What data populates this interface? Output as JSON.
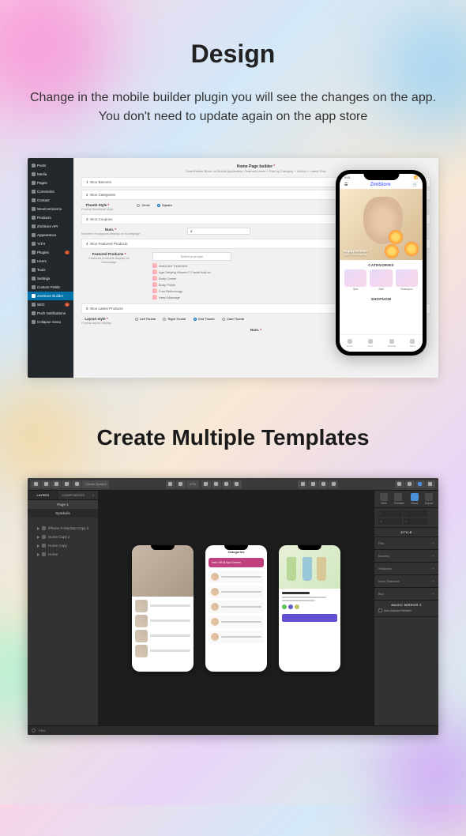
{
  "heading1": "Design",
  "subtitle": "Change in the mobile builder plugin you will see the changes on the app. You don't need to update again on the app store",
  "heading2": "Create Multiple Templates",
  "wp": {
    "sidebar": [
      {
        "label": "Posts"
      },
      {
        "label": "Media"
      },
      {
        "label": "Pages"
      },
      {
        "label": "Comments"
      },
      {
        "label": "Contact"
      },
      {
        "label": "WooCommerce"
      },
      {
        "label": "Products"
      },
      {
        "label": "ZiniStore API"
      },
      {
        "label": "Appearance"
      },
      {
        "label": "YITH"
      },
      {
        "label": "Plugins",
        "badge": "1"
      },
      {
        "label": "Users"
      },
      {
        "label": "Tools"
      },
      {
        "label": "Settings"
      },
      {
        "label": "Custom Fields"
      },
      {
        "label": "ZiniStore Builder",
        "active": true
      },
      {
        "label": "SEO",
        "badge": "1"
      },
      {
        "label": "Push Notifications"
      },
      {
        "label": "Collapse menu"
      }
    ],
    "title": "Home Page builder",
    "desc": "Data Builder Block on Mobile Application: Featured news + Post by Category + Videos + Latest Post",
    "rows": {
      "banners": "Woo Banners",
      "categories": "Woo Categories",
      "coupons": "Woo Coupons",
      "featured": "Woo Featured Products",
      "latest": "Woo Latest Products"
    },
    "fields": {
      "thumb_label": "Thumb Style",
      "thumb_desc": "Format thumbnail style",
      "thumb_circle": "Circle",
      "thumb_square": "Square",
      "num_label": "Num.",
      "num_desc": "Number of coupons display on homepage",
      "num_value": "3",
      "featured_label": "Featured Products",
      "featured_desc": "Featured products display on homepage",
      "select_placeholder": "Select post type",
      "layout_label": "Layout style",
      "layout_desc": "Format layout display",
      "layout_left": "Left Thumb",
      "layout_right": "Right Thumb",
      "layout_grid": "Grid Thumb",
      "layout_card": "Card Thumb",
      "num2_label": "Num."
    },
    "products": [
      "Abdomen Treatment",
      "Age Defying Vitamin C Facial Add-on",
      "Body Cream",
      "Body Polish",
      "Foot Reflexology",
      "Head Massage"
    ]
  },
  "phone": {
    "time": "9:41",
    "brand": "ZiniStore",
    "hero_title": "Happy Winter!",
    "hero_sub": "Sale off everything",
    "cat_title": "CATEGORIES",
    "cats": [
      "Spa",
      "Nail",
      "Shampoo"
    ],
    "shop_title": "SHOPNOW",
    "tabs": [
      "Home",
      "Shop",
      "Wishlist",
      "More"
    ]
  },
  "editor": {
    "toolbar": {
      "insert": "Insert",
      "symbols": "Symbols",
      "group": "Group",
      "ungroup": "Ungroup",
      "create_symbol": "Create Symbol",
      "forward": "Forward",
      "backward": "Backward",
      "zoom": "Zoom",
      "zoom_pct": "67%",
      "edit": "Edit",
      "rotate": "Rotate",
      "flatten": "Flatten",
      "scale": "Scale",
      "union": "Union",
      "subtract": "Subtract",
      "intersect": "Intersect",
      "difference": "Difference",
      "view": "View",
      "preview": "Preview",
      "cloud": "Cloud",
      "export": "Export"
    },
    "left": {
      "tab_layers": "LAYERS",
      "tab_components": "COMPONENTS",
      "page": "Page 1",
      "symbols": "Symbols",
      "layers": [
        "iPhone-X-Mockup Copy 2",
        "Home Copy 2",
        "Home Copy",
        "Home"
      ]
    },
    "right": {
      "view": "View",
      "preview": "Preview",
      "cloud": "Cloud",
      "export": "Export",
      "style": "STYLE",
      "fills": "Fills",
      "borders": "Borders",
      "shadows": "Shadows",
      "inner_shadows": "Inner Shadows",
      "blur": "Blur",
      "magic_mirror": "MAGIC MIRROR 3",
      "auto_refresh": "Auto Artboard Refresh"
    },
    "mock2_header": "Categories",
    "mock2_banner": "Sale Off All Spa Service",
    "footer_filter": "Filter"
  }
}
